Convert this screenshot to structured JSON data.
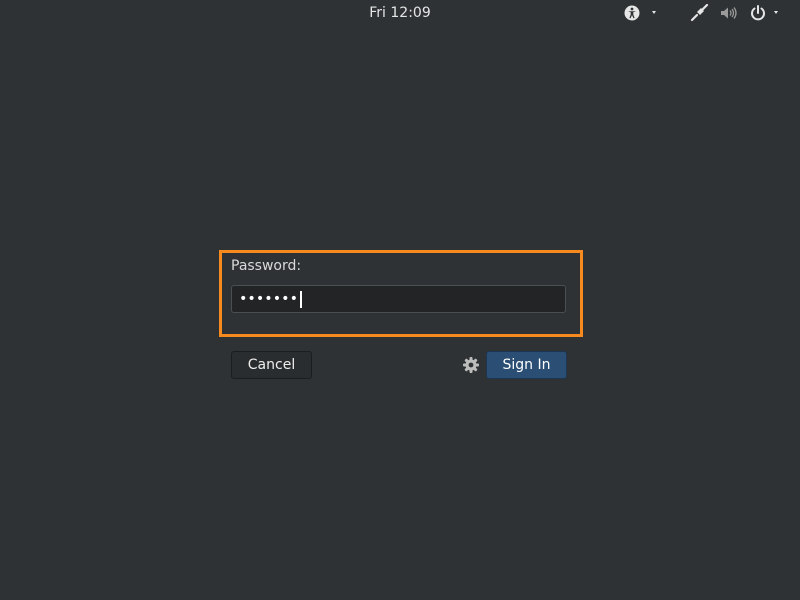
{
  "topbar": {
    "clock": "Fri 12:09",
    "icons": {
      "accessibility": "accessibility-icon",
      "network": "network-icon",
      "volume": "volume-icon",
      "power": "power-icon"
    }
  },
  "login": {
    "password_label": "Password:",
    "password_value": "•••••••",
    "cancel_label": "Cancel",
    "signin_label": "Sign In",
    "session_icon": "gear-icon"
  },
  "colors": {
    "background": "#2e3234",
    "highlight": "#f68a1e",
    "signin_button": "#2b4e74"
  }
}
